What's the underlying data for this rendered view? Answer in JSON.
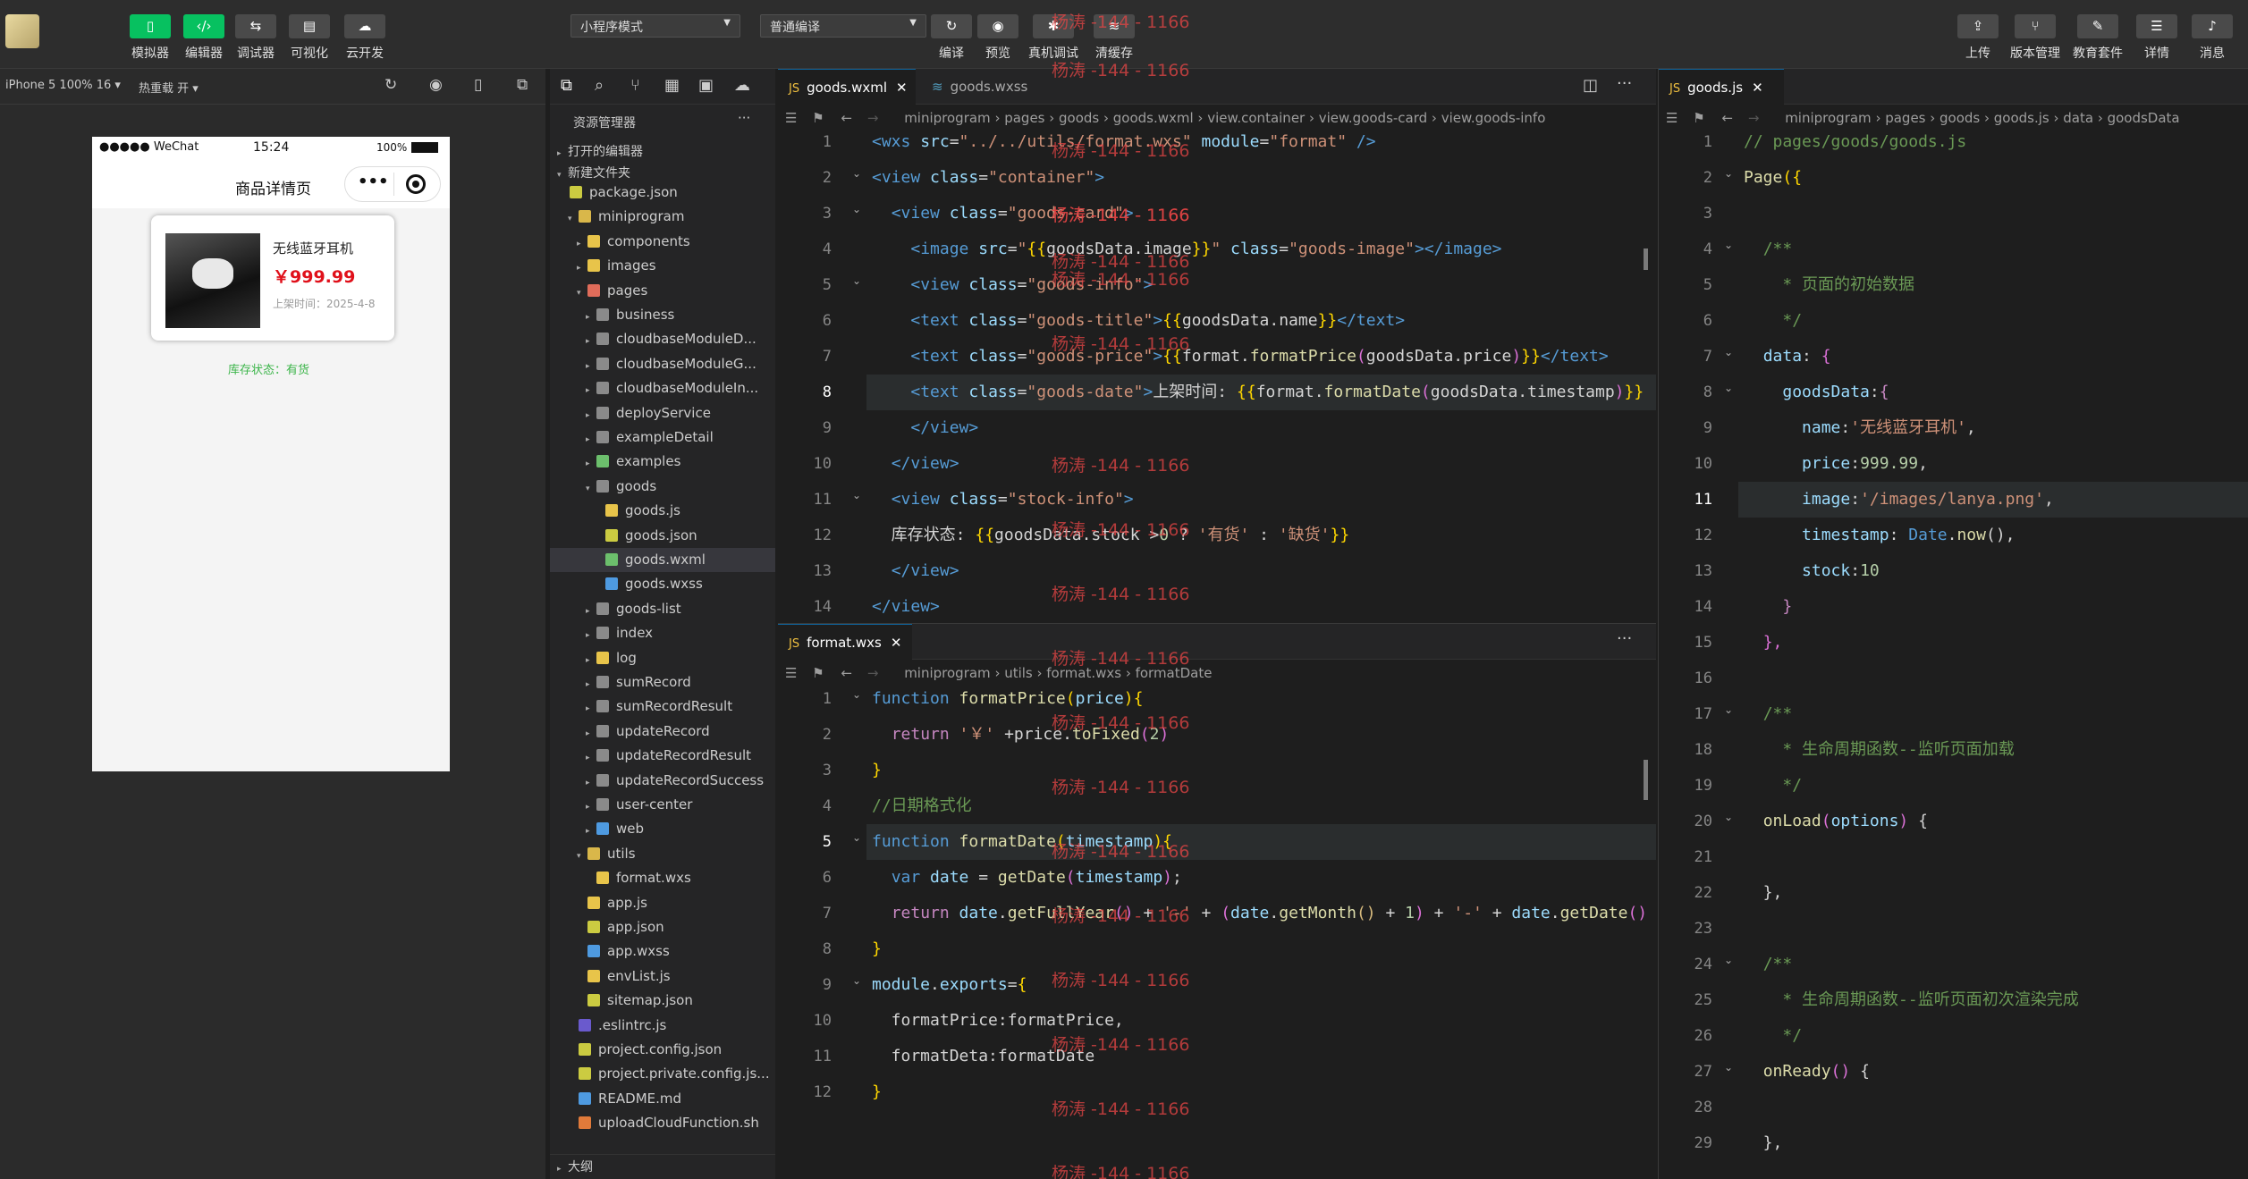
{
  "toolbar": {
    "left": [
      {
        "icon": "phone-icon",
        "label": "模拟器"
      },
      {
        "icon": "code-icon",
        "label": "编辑器"
      },
      {
        "icon": "debug-icon",
        "label": "调试器"
      },
      {
        "icon": "layout-icon",
        "label": "可视化"
      },
      {
        "icon": "cloud-icon",
        "label": "云开发"
      }
    ],
    "mode_select": "小程序模式",
    "compile_select": "普通编译",
    "mid": [
      {
        "icon": "refresh-icon",
        "label": "编译"
      },
      {
        "icon": "eye-icon",
        "label": "预览"
      },
      {
        "icon": "bug-icon",
        "label": "真机调试"
      },
      {
        "icon": "layers-icon",
        "label": "清缓存"
      }
    ],
    "right": [
      {
        "icon": "upload-icon",
        "label": "上传"
      },
      {
        "icon": "branch-icon",
        "label": "版本管理"
      },
      {
        "icon": "graduation-icon",
        "label": "教育套件"
      },
      {
        "icon": "menu-icon",
        "label": "详情"
      },
      {
        "icon": "bell-icon",
        "label": "消息"
      }
    ]
  },
  "simbar": {
    "device": "iPhone 5 100% 16 ▾",
    "hotreload": "热重载 开 ▾"
  },
  "phone": {
    "carrier": "●●●●● WeChat",
    "time": "15:24",
    "battery": "100%",
    "title": "商品详情页",
    "product_name": "无线蓝牙耳机",
    "price": "￥999.99",
    "date": "上架时间：2025-4-8",
    "stock": "库存状态：有货"
  },
  "explorer": {
    "title": "资源管理器",
    "open_editors": "打开的编辑器",
    "folder": "新建文件夹",
    "outline": "大纲",
    "rows": [
      {
        "d": 0,
        "t": "package.json",
        "i": "json",
        "a": ""
      },
      {
        "d": 1,
        "t": "miniprogram",
        "i": "folder-open",
        "a": "▾"
      },
      {
        "d": 2,
        "t": "components",
        "i": "folder-y",
        "a": "▸"
      },
      {
        "d": 2,
        "t": "images",
        "i": "folder-y",
        "a": "▸"
      },
      {
        "d": 2,
        "t": "pages",
        "i": "folder-r",
        "a": "▾"
      },
      {
        "d": 3,
        "t": "business",
        "i": "folder",
        "a": "▸"
      },
      {
        "d": 3,
        "t": "cloudbaseModuleD...",
        "i": "folder",
        "a": "▸"
      },
      {
        "d": 3,
        "t": "cloudbaseModuleG...",
        "i": "folder",
        "a": "▸"
      },
      {
        "d": 3,
        "t": "cloudbaseModuleIn...",
        "i": "folder",
        "a": "▸"
      },
      {
        "d": 3,
        "t": "deployService",
        "i": "folder",
        "a": "▸"
      },
      {
        "d": 3,
        "t": "exampleDetail",
        "i": "folder",
        "a": "▸"
      },
      {
        "d": 3,
        "t": "examples",
        "i": "folder-g",
        "a": "▸"
      },
      {
        "d": 3,
        "t": "goods",
        "i": "folder",
        "a": "▾"
      },
      {
        "d": 4,
        "t": "goods.js",
        "i": "js",
        "a": ""
      },
      {
        "d": 4,
        "t": "goods.json",
        "i": "json",
        "a": ""
      },
      {
        "d": 4,
        "t": "goods.wxml",
        "i": "wxml",
        "a": "",
        "sel": true
      },
      {
        "d": 4,
        "t": "goods.wxss",
        "i": "wxss",
        "a": ""
      },
      {
        "d": 3,
        "t": "goods-list",
        "i": "folder",
        "a": "▸"
      },
      {
        "d": 3,
        "t": "index",
        "i": "folder",
        "a": "▸"
      },
      {
        "d": 3,
        "t": "log",
        "i": "folder-y",
        "a": "▸"
      },
      {
        "d": 3,
        "t": "sumRecord",
        "i": "folder",
        "a": "▸"
      },
      {
        "d": 3,
        "t": "sumRecordResult",
        "i": "folder",
        "a": "▸"
      },
      {
        "d": 3,
        "t": "updateRecord",
        "i": "folder",
        "a": "▸"
      },
      {
        "d": 3,
        "t": "updateRecordResult",
        "i": "folder",
        "a": "▸"
      },
      {
        "d": 3,
        "t": "updateRecordSuccess",
        "i": "folder",
        "a": "▸"
      },
      {
        "d": 3,
        "t": "user-center",
        "i": "folder",
        "a": "▸"
      },
      {
        "d": 3,
        "t": "web",
        "i": "folder-b",
        "a": "▸"
      },
      {
        "d": 2,
        "t": "utils",
        "i": "folder-open",
        "a": "▾"
      },
      {
        "d": 3,
        "t": "format.wxs",
        "i": "js",
        "a": ""
      },
      {
        "d": 2,
        "t": "app.js",
        "i": "js",
        "a": ""
      },
      {
        "d": 2,
        "t": "app.json",
        "i": "json",
        "a": ""
      },
      {
        "d": 2,
        "t": "app.wxss",
        "i": "wxss",
        "a": ""
      },
      {
        "d": 2,
        "t": "envList.js",
        "i": "js",
        "a": ""
      },
      {
        "d": 2,
        "t": "sitemap.json",
        "i": "json",
        "a": ""
      },
      {
        "d": 1,
        "t": ".eslintrc.js",
        "i": "eslint",
        "a": ""
      },
      {
        "d": 1,
        "t": "project.config.json",
        "i": "json",
        "a": ""
      },
      {
        "d": 1,
        "t": "project.private.config.js...",
        "i": "json",
        "a": ""
      },
      {
        "d": 1,
        "t": "README.md",
        "i": "info",
        "a": ""
      },
      {
        "d": 1,
        "t": "uploadCloudFunction.sh",
        "i": "sh",
        "a": ""
      }
    ]
  },
  "editor1": {
    "tab1": "goods.wxml",
    "tab2": "goods.wxss",
    "breadcrumb": "miniprogram  ›  pages  ›  goods  ›   goods.wxml  ›   view.container  ›   view.goods-card  ›   view.goods-info",
    "lines": [
      [
        [
          "t",
          "<wxs "
        ],
        [
          "a",
          "src"
        ],
        [
          "w",
          "="
        ],
        [
          "s",
          "\"../../utils/format.wxs\""
        ],
        [
          "w",
          " "
        ],
        [
          "a",
          "module"
        ],
        [
          "w",
          "="
        ],
        [
          "s",
          "\"format\""
        ],
        [
          "t",
          " />"
        ]
      ],
      [
        [
          "t",
          "<view "
        ],
        [
          "a",
          "class"
        ],
        [
          "w",
          "="
        ],
        [
          "s",
          "\"container\""
        ],
        [
          "t",
          ">"
        ]
      ],
      [
        [
          "w",
          "  "
        ],
        [
          "t",
          "<view "
        ],
        [
          "a",
          "class"
        ],
        [
          "w",
          "="
        ],
        [
          "s",
          "\"goods-card\""
        ],
        [
          "t",
          ">"
        ]
      ],
      [
        [
          "w",
          "    "
        ],
        [
          "t",
          "<image "
        ],
        [
          "a",
          "src"
        ],
        [
          "w",
          "="
        ],
        [
          "s",
          "\""
        ],
        [
          "y",
          "{{"
        ],
        [
          "w",
          "goodsData.image"
        ],
        [
          "y",
          "}}"
        ],
        [
          "s",
          "\""
        ],
        [
          "w",
          " "
        ],
        [
          "a",
          "class"
        ],
        [
          "w",
          "="
        ],
        [
          "s",
          "\"goods-image\""
        ],
        [
          "t",
          "></image>"
        ]
      ],
      [
        [
          "w",
          "    "
        ],
        [
          "t",
          "<view "
        ],
        [
          "a",
          "class"
        ],
        [
          "w",
          "="
        ],
        [
          "s",
          "\"goods-info\""
        ],
        [
          "t",
          ">"
        ]
      ],
      [
        [
          "w",
          "    "
        ],
        [
          "t",
          "<text "
        ],
        [
          "a",
          "class"
        ],
        [
          "w",
          "="
        ],
        [
          "s",
          "\"goods-title\""
        ],
        [
          "t",
          ">"
        ],
        [
          "y",
          "{{"
        ],
        [
          "w",
          "goodsData.name"
        ],
        [
          "y",
          "}}"
        ],
        [
          "t",
          "</text>"
        ]
      ],
      [
        [
          "w",
          "    "
        ],
        [
          "t",
          "<text "
        ],
        [
          "a",
          "class"
        ],
        [
          "w",
          "="
        ],
        [
          "s",
          "\"goods-price\""
        ],
        [
          "t",
          ">"
        ],
        [
          "y",
          "{{"
        ],
        [
          "w",
          "format."
        ],
        [
          "f",
          "formatPrice"
        ],
        [
          "p",
          "("
        ],
        [
          "w",
          "goodsData.price"
        ],
        [
          "p",
          ")"
        ],
        [
          "y",
          "}}"
        ],
        [
          "t",
          "</text>"
        ]
      ],
      [
        [
          "w",
          "    "
        ],
        [
          "t",
          "<text "
        ],
        [
          "a",
          "class"
        ],
        [
          "w",
          "="
        ],
        [
          "s",
          "\"goods-date\""
        ],
        [
          "t",
          ">"
        ],
        [
          "w",
          "上架时间: "
        ],
        [
          "y",
          "{{"
        ],
        [
          "w",
          "format."
        ],
        [
          "f",
          "formatDate"
        ],
        [
          "p",
          "("
        ],
        [
          "w",
          "goodsData.timestamp"
        ],
        [
          "p",
          ")"
        ],
        [
          "y",
          "}}"
        ]
      ],
      [
        [
          "w",
          "    "
        ],
        [
          "t",
          "</view>"
        ]
      ],
      [
        [
          "w",
          "  "
        ],
        [
          "t",
          "</view>"
        ]
      ],
      [
        [
          "w",
          "  "
        ],
        [
          "t",
          "<view "
        ],
        [
          "a",
          "class"
        ],
        [
          "w",
          "="
        ],
        [
          "s",
          "\"stock-info\""
        ],
        [
          "t",
          ">"
        ]
      ],
      [
        [
          "w",
          "  库存状态: "
        ],
        [
          "y",
          "{{"
        ],
        [
          "w",
          "goodsData.stock >"
        ],
        [
          "n",
          "0"
        ],
        [
          "w",
          " ? "
        ],
        [
          "s",
          "'有货'"
        ],
        [
          "w",
          " : "
        ],
        [
          "s",
          "'缺货'"
        ],
        [
          "y",
          "}}"
        ]
      ],
      [
        [
          "w",
          "  "
        ],
        [
          "t",
          "</view>"
        ]
      ],
      [
        [
          "t",
          "</view>"
        ]
      ]
    ]
  },
  "editor2": {
    "tab": "format.wxs",
    "breadcrumb": "miniprogram  ›  utils  ›   format.wxs  ›   formatDate",
    "lines": [
      [
        [
          "t",
          "function "
        ],
        [
          "f",
          "formatPrice"
        ],
        [
          "y",
          "("
        ],
        [
          "a",
          "price"
        ],
        [
          "y",
          ")"
        ],
        [
          "y",
          "{"
        ]
      ],
      [
        [
          "w",
          "  "
        ],
        [
          "k",
          "return "
        ],
        [
          "s",
          "'￥' "
        ],
        [
          "w",
          "+price."
        ],
        [
          "f",
          "toFixed"
        ],
        [
          "p",
          "("
        ],
        [
          "n",
          "2"
        ],
        [
          "p",
          ")"
        ]
      ],
      [
        [
          "y",
          "}"
        ]
      ],
      [
        [
          "c",
          "//日期格式化"
        ]
      ],
      [
        [
          "t",
          "function "
        ],
        [
          "f",
          "formatDate"
        ],
        [
          "y",
          "("
        ],
        [
          "a",
          "timestamp"
        ],
        [
          "y",
          ")"
        ],
        [
          "y",
          "{"
        ]
      ],
      [
        [
          "w",
          "  "
        ],
        [
          "t",
          "var "
        ],
        [
          "a",
          "date"
        ],
        [
          "w",
          " = "
        ],
        [
          "f",
          "getDate"
        ],
        [
          "p",
          "("
        ],
        [
          "a",
          "timestamp"
        ],
        [
          "p",
          ")"
        ],
        [
          "w",
          ";"
        ]
      ],
      [
        [
          "w",
          "  "
        ],
        [
          "k",
          "return "
        ],
        [
          "a",
          "date"
        ],
        [
          "w",
          "."
        ],
        [
          "f",
          "getFullYear"
        ],
        [
          "p",
          "()"
        ],
        [
          "w",
          " + "
        ],
        [
          "s",
          "'-'"
        ],
        [
          "w",
          " + "
        ],
        [
          "p",
          "("
        ],
        [
          "a",
          "date"
        ],
        [
          "w",
          "."
        ],
        [
          "f",
          "getMonth"
        ],
        [
          "o",
          "()"
        ],
        [
          "w",
          " + "
        ],
        [
          "n",
          "1"
        ],
        [
          "p",
          ")"
        ],
        [
          "w",
          " + "
        ],
        [
          "s",
          "'-'"
        ],
        [
          "w",
          " + "
        ],
        [
          "a",
          "date"
        ],
        [
          "w",
          "."
        ],
        [
          "f",
          "getDate"
        ],
        [
          "p",
          "()"
        ]
      ],
      [
        [
          "y",
          "}"
        ]
      ],
      [
        [
          "a",
          "module"
        ],
        [
          "w",
          "."
        ],
        [
          "a",
          "exports"
        ],
        [
          "w",
          "="
        ],
        [
          "y",
          "{"
        ]
      ],
      [
        [
          "w",
          "  formatPrice:formatPrice,"
        ]
      ],
      [
        [
          "w",
          "  formatDeta:formatDate"
        ]
      ],
      [
        [
          "y",
          "}"
        ]
      ]
    ]
  },
  "editor3": {
    "tab": "goods.js",
    "breadcrumb": "miniprogram  ›  pages  ›  goods  ›   goods.js  ›   data  ›   goodsData",
    "lines": [
      [
        [
          "c",
          "// pages/goods/goods.js"
        ]
      ],
      [
        [
          "f",
          "Page"
        ],
        [
          "y",
          "({"
        ]
      ],
      [
        [
          "w",
          ""
        ]
      ],
      [
        [
          "w",
          "  "
        ],
        [
          "c",
          "/**"
        ]
      ],
      [
        [
          "w",
          "  "
        ],
        [
          "c",
          "  * 页面的初始数据"
        ]
      ],
      [
        [
          "w",
          "  "
        ],
        [
          "c",
          "  */"
        ]
      ],
      [
        [
          "w",
          "  "
        ],
        [
          "a",
          "data"
        ],
        [
          "w",
          ": "
        ],
        [
          "p",
          "{"
        ]
      ],
      [
        [
          "w",
          "    "
        ],
        [
          "a",
          "goodsData"
        ],
        [
          "w",
          ":"
        ],
        [
          "k",
          "{"
        ]
      ],
      [
        [
          "w",
          "      "
        ],
        [
          "a",
          "name"
        ],
        [
          "w",
          ":"
        ],
        [
          "s",
          "'无线蓝牙耳机'"
        ],
        [
          "w",
          ","
        ]
      ],
      [
        [
          "w",
          "      "
        ],
        [
          "a",
          "price"
        ],
        [
          "w",
          ":"
        ],
        [
          "n",
          "999.99"
        ],
        [
          "w",
          ","
        ]
      ],
      [
        [
          "w",
          "      "
        ],
        [
          "a",
          "image"
        ],
        [
          "w",
          ":"
        ],
        [
          "s",
          "'/images/lanya.png'"
        ],
        [
          "w",
          ","
        ]
      ],
      [
        [
          "w",
          "      "
        ],
        [
          "a",
          "timestamp"
        ],
        [
          "w",
          ": "
        ],
        [
          "t",
          "Date"
        ],
        [
          "w",
          "."
        ],
        [
          "f",
          "now"
        ],
        [
          "w",
          "(),"
        ]
      ],
      [
        [
          "w",
          "      "
        ],
        [
          "a",
          "stock"
        ],
        [
          "w",
          ":"
        ],
        [
          "n",
          "10"
        ]
      ],
      [
        [
          "w",
          "    "
        ],
        [
          "k",
          "}"
        ]
      ],
      [
        [
          "w",
          "  "
        ],
        [
          "p",
          "},"
        ]
      ],
      [
        [
          "w",
          ""
        ]
      ],
      [
        [
          "w",
          "  "
        ],
        [
          "c",
          "/**"
        ]
      ],
      [
        [
          "w",
          "  "
        ],
        [
          "c",
          "  * 生命周期函数--监听页面加载"
        ]
      ],
      [
        [
          "w",
          "  "
        ],
        [
          "c",
          "  */"
        ]
      ],
      [
        [
          "w",
          "  "
        ],
        [
          "f",
          "onLoad"
        ],
        [
          "p",
          "("
        ],
        [
          "a",
          "options"
        ],
        [
          "p",
          ")"
        ],
        [
          "w",
          " {"
        ]
      ],
      [
        [
          "w",
          ""
        ]
      ],
      [
        [
          "w",
          "  },"
        ]
      ],
      [
        [
          "w",
          ""
        ]
      ],
      [
        [
          "w",
          "  "
        ],
        [
          "c",
          "/**"
        ]
      ],
      [
        [
          "w",
          "  "
        ],
        [
          "c",
          "  * 生命周期函数--监听页面初次渲染完成"
        ]
      ],
      [
        [
          "w",
          "  "
        ],
        [
          "c",
          "  */"
        ]
      ],
      [
        [
          "w",
          "  "
        ],
        [
          "f",
          "onReady"
        ],
        [
          "p",
          "()"
        ],
        [
          "w",
          " {"
        ]
      ],
      [
        [
          "w",
          ""
        ]
      ],
      [
        [
          "w",
          "  },"
        ]
      ]
    ]
  },
  "watermark": "杨涛 -144 - 1166"
}
